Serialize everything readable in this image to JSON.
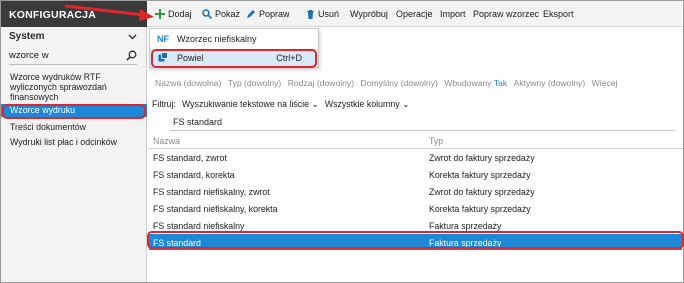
{
  "app": {
    "section_title": "KONFIGURACJA"
  },
  "toolbar": {
    "add": "Dodaj",
    "show": "Pokaż",
    "edit": "Popraw",
    "delete": "Usuń",
    "select": "Wypróbuj",
    "operations": "Operacje",
    "import": "Import",
    "edit_template": "Popraw wzorzec",
    "export": "Eksport"
  },
  "sidebar": {
    "selector_value": "System",
    "search_value": "wzorce w",
    "items": [
      {
        "label": "Wzorce wydruków RTF wyliczonych sprawozdań finansowych"
      },
      {
        "label": "Wzorce wydruku"
      },
      {
        "label": "Treści dokumentów"
      },
      {
        "label": "Wydruki list płac i odcinków"
      }
    ]
  },
  "add_menu": {
    "items": [
      {
        "icon_text": "NF",
        "label": "Wzorzec niefiskalny",
        "shortcut": ""
      },
      {
        "icon_text": "",
        "label": "Powiel",
        "shortcut": "Ctrl+D"
      }
    ]
  },
  "columns_bar": {
    "name": "Nazwa (dowolna)",
    "type": "Typ (dowolny)",
    "kind": "Rodzaj (dowolny)",
    "default": "Domyślny (dowolny)",
    "builtin_label": "Wbudowany",
    "builtin_value": "Tak",
    "active": "Aktywny (dowolny)",
    "more": "Więcej"
  },
  "filter": {
    "label": "Filtruj:",
    "mode": "Wyszukiwanie tekstowe na liście",
    "columns": "Wszystkie kolumny",
    "text": "FS standard"
  },
  "table": {
    "headers": [
      "Nazwa",
      "Typ"
    ],
    "rows": [
      {
        "name": "FS standard, zwrot",
        "type": "Zwrot do faktury sprzedaży"
      },
      {
        "name": "FS standard, korekta",
        "type": "Korekta faktury sprzedaży"
      },
      {
        "name": "FS standard niefiskalny, zwrot",
        "type": "Zwrot do faktury sprzedaży"
      },
      {
        "name": "FS standard niefiskalny, korekta",
        "type": "Korekta faktury sprzedaży"
      },
      {
        "name": "FS standard niefiskalny",
        "type": "Faktura sprzedaży"
      },
      {
        "name": "FS standard",
        "type": "Faktura sprzedaży"
      }
    ],
    "selected_row": "FS standard"
  },
  "colors": {
    "accent": "#1d87d8",
    "annotation": "#e0252c",
    "topbar": "#3a3a3a"
  }
}
